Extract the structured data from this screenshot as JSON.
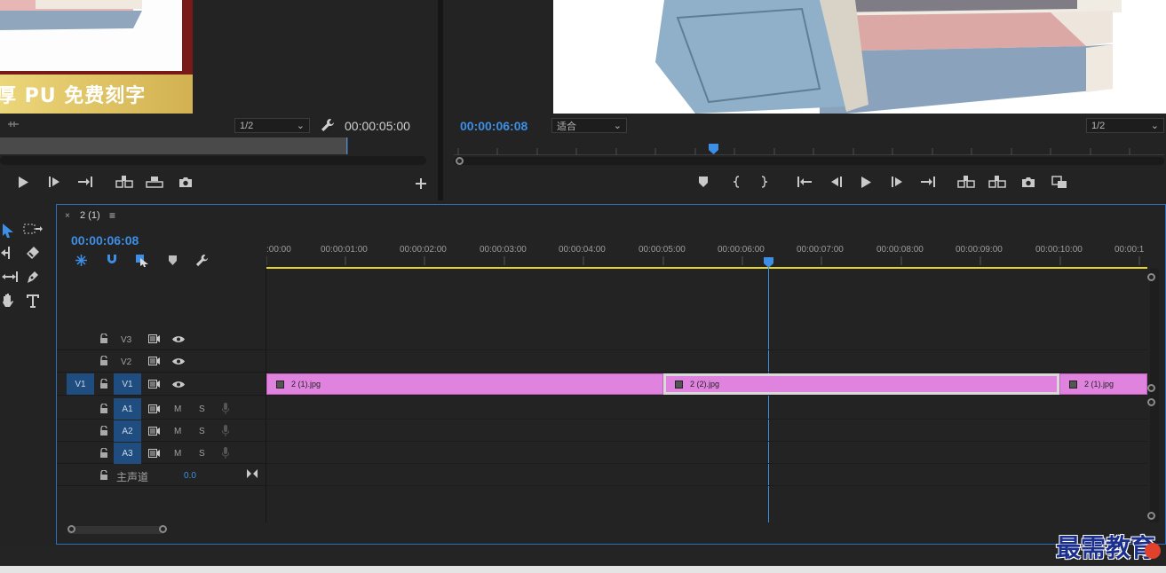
{
  "source_monitor": {
    "banner_text": "厚 PU 免费刻字",
    "resolution": "1/2",
    "timecode": "00:00:05:00"
  },
  "program_monitor": {
    "timecode": "00:00:06:08",
    "fit": "适合",
    "resolution": "1/2"
  },
  "timeline": {
    "tab_label": "2 (1)",
    "close_glyph": "×",
    "menu_glyph": "≡",
    "timecode": "00:00:06:08",
    "ruler": [
      ":00:00",
      "00:00:01:00",
      "00:00:02:00",
      "00:00:03:00",
      "00:00:04:00",
      "00:00:05:00",
      "00:00:06:00",
      "00:00:07:00",
      "00:00:08:00",
      "00:00:09:00",
      "00:00:10:00",
      "00:00:1"
    ],
    "tracks": {
      "v3": "V3",
      "v2": "V2",
      "v1": "V1",
      "v1_source": "V1",
      "a1": "A1",
      "a2": "A2",
      "a3": "A3",
      "mute": "M",
      "solo": "S",
      "master_label": "主声道",
      "master_value": "0.0"
    },
    "clips": [
      "2 (1).jpg",
      "2 (2).jpg",
      "2 (1).jpg"
    ]
  },
  "watermark": "最需教育",
  "colors": {
    "accent": "#3d8ee5",
    "clip": "#e083df",
    "track_patch": "#1f4d80",
    "work_area": "#e5d52a"
  }
}
